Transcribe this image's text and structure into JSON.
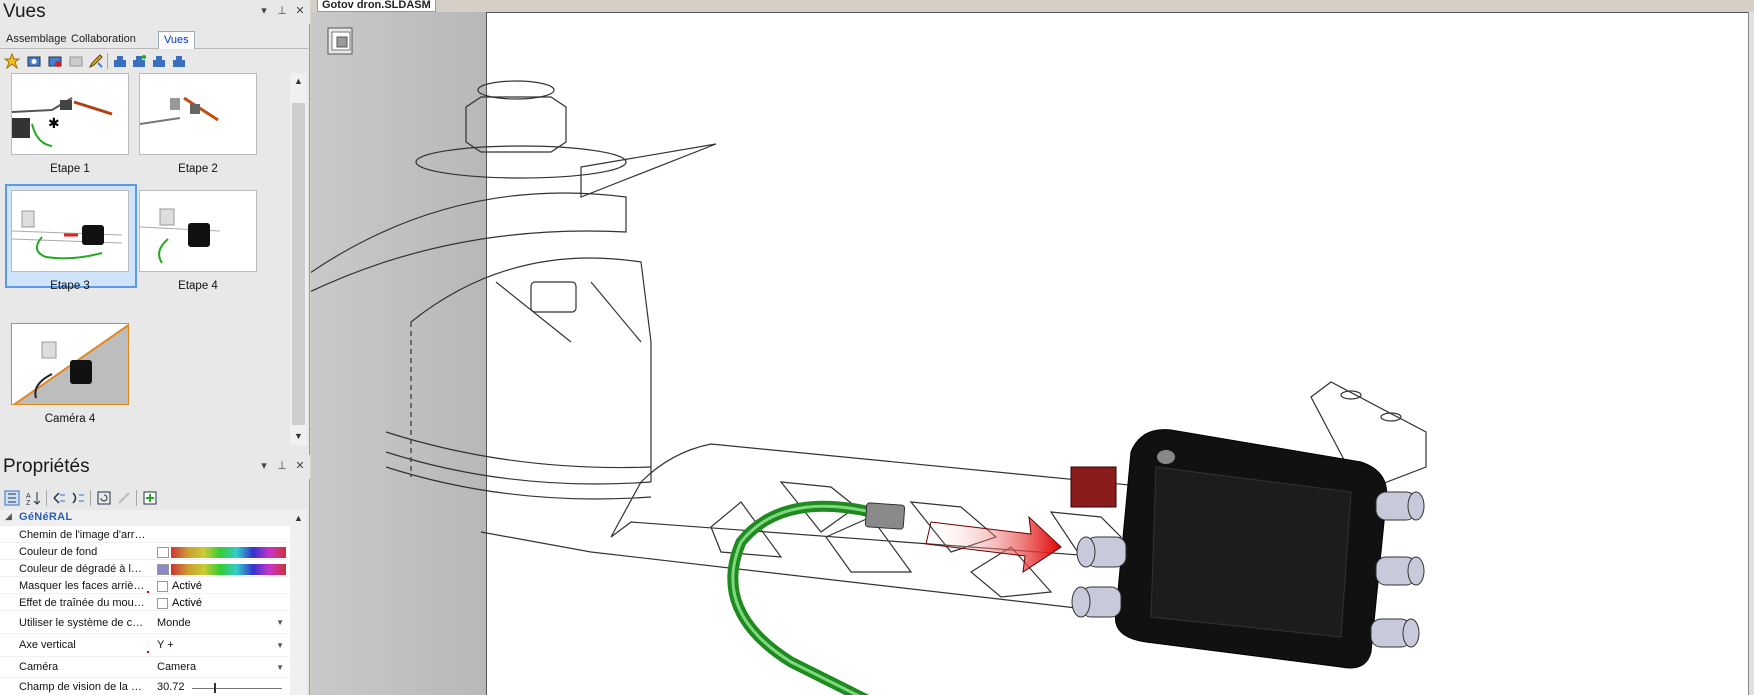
{
  "vues_pane": {
    "title": "Vues",
    "tabs": [
      "Assemblage",
      "Collaboration",
      "Vues"
    ],
    "active_tab": "Vues",
    "thumbnails": [
      {
        "label": "Etape 1",
        "selected": false
      },
      {
        "label": "Etape 2",
        "selected": false
      },
      {
        "label": "Etape 3",
        "selected": true
      },
      {
        "label": "Etape 4",
        "selected": false
      },
      {
        "label": "Caméra 4",
        "selected": false
      }
    ]
  },
  "props_pane": {
    "title": "Propriétés",
    "group": "GéNéRAL",
    "rows": [
      {
        "name": "Chemin de l'image d'arriè...",
        "value": ""
      },
      {
        "name": "Couleur de fond",
        "value": ""
      },
      {
        "name": "Couleur de dégradé à la ...",
        "value": ""
      },
      {
        "name": "Masquer les faces arrières",
        "value": "Activé"
      },
      {
        "name": "Effet de traînée du mouv...",
        "value": "Activé"
      },
      {
        "name": "Utiliser le système de coo...",
        "value": "Monde"
      },
      {
        "name": "Axe vertical",
        "value": "Y +"
      },
      {
        "name": "Caméra",
        "value": "Camera"
      },
      {
        "name": "Champ de vision de la ca...",
        "value": "30.72"
      }
    ],
    "colors": {
      "background_swatch": "#ffffff",
      "gradient_swatch": "#8a8ac8"
    }
  },
  "document": {
    "tab_title": "Gotov dron.SLDASM"
  },
  "colors": {
    "accent": "#2b5fb4",
    "selection": "#5b9be6",
    "cable": "#2e9e2e",
    "arrow": "#e02020",
    "esc_body": "#111111"
  }
}
